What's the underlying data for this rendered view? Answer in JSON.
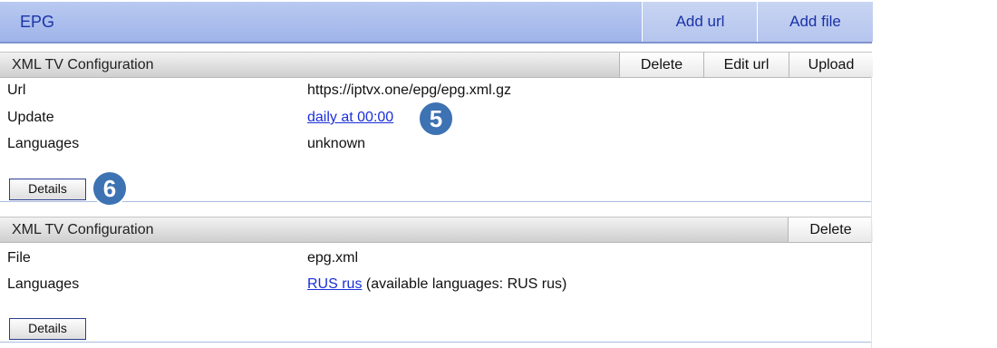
{
  "header": {
    "title": "EPG",
    "add_url_label": "Add url",
    "add_file_label": "Add file"
  },
  "configs": [
    {
      "title": "XML TV Configuration",
      "buttons": {
        "delete": "Delete",
        "edit_url": "Edit url",
        "upload": "Upload"
      },
      "fields": [
        {
          "label": "Url",
          "value": "https://iptvx.one/epg/epg.xml.gz"
        },
        {
          "label": "Update",
          "value": "daily at 00:00"
        },
        {
          "label": "Languages",
          "value": "unknown"
        }
      ],
      "details_label": "Details"
    },
    {
      "title": "XML TV Configuration",
      "buttons": {
        "delete": "Delete"
      },
      "fields": [
        {
          "label": "File",
          "value": "epg.xml"
        },
        {
          "label": "Languages",
          "value": "RUS rus",
          "note": "(available languages: RUS rus)"
        }
      ],
      "details_label": "Details"
    }
  ],
  "callouts": {
    "update_badge": "5",
    "details_badge": "6"
  },
  "colors": {
    "header_bg": "#a9bcec",
    "header_text": "#1a33a8",
    "link": "#1a2fd8",
    "badge": "#3d72b3"
  }
}
